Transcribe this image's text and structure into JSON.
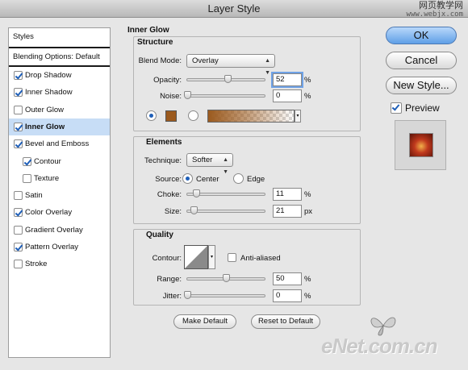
{
  "window": {
    "title": "Layer Style"
  },
  "watermarks": {
    "top_cn": "网页教学网",
    "top_url": "www.webjx.com",
    "logo_bottom": "eNet.com.cn"
  },
  "styles_list": {
    "header": "Styles",
    "blending_options": "Blending Options: Default",
    "items": [
      {
        "label": "Drop Shadow",
        "checked": true
      },
      {
        "label": "Inner Shadow",
        "checked": true
      },
      {
        "label": "Outer Glow",
        "checked": false
      },
      {
        "label": "Inner Glow",
        "checked": true,
        "selected": true
      },
      {
        "label": "Bevel and Emboss",
        "checked": true
      },
      {
        "label": "Contour",
        "checked": true,
        "indent": true
      },
      {
        "label": "Texture",
        "checked": false,
        "indent": true
      },
      {
        "label": "Satin",
        "checked": false
      },
      {
        "label": "Color Overlay",
        "checked": true
      },
      {
        "label": "Gradient Overlay",
        "checked": false
      },
      {
        "label": "Pattern Overlay",
        "checked": true
      },
      {
        "label": "Stroke",
        "checked": false
      }
    ]
  },
  "inner_glow": {
    "title": "Inner Glow",
    "structure": {
      "title": "Structure",
      "blend_mode_label": "Blend Mode:",
      "blend_mode": "Overlay",
      "opacity_label": "Opacity:",
      "opacity": "52",
      "opacity_level": 0.52,
      "opacity_unit": "%",
      "noise_label": "Noise:",
      "noise": "0",
      "noise_level": 0,
      "noise_unit": "%",
      "glow_color": "#9b5a1e",
      "source_mode": "color"
    },
    "elements": {
      "title": "Elements",
      "technique_label": "Technique:",
      "technique": "Softer",
      "source_label": "Source:",
      "source_center": "Center",
      "source_edge": "Edge",
      "source_selected": "center",
      "choke_label": "Choke:",
      "choke": "11",
      "choke_level": 0.11,
      "choke_unit": "%",
      "size_label": "Size:",
      "size": "21",
      "size_level": 0.085,
      "size_unit": "px"
    },
    "quality": {
      "title": "Quality",
      "contour_label": "Contour:",
      "anti_aliased_label": "Anti-aliased",
      "anti_aliased": false,
      "range_label": "Range:",
      "range": "50",
      "range_level": 0.5,
      "range_unit": "%",
      "jitter_label": "Jitter:",
      "jitter": "0",
      "jitter_level": 0,
      "jitter_unit": "%"
    },
    "make_default": "Make Default",
    "reset_default": "Reset to Default"
  },
  "actions": {
    "ok": "OK",
    "cancel": "Cancel",
    "new_style": "New Style...",
    "preview_label": "Preview",
    "preview_checked": true
  },
  "colors": {
    "accent": "#1f5fb8",
    "selection": "#c7ddf6",
    "ok_button": "#5f9fe7"
  }
}
